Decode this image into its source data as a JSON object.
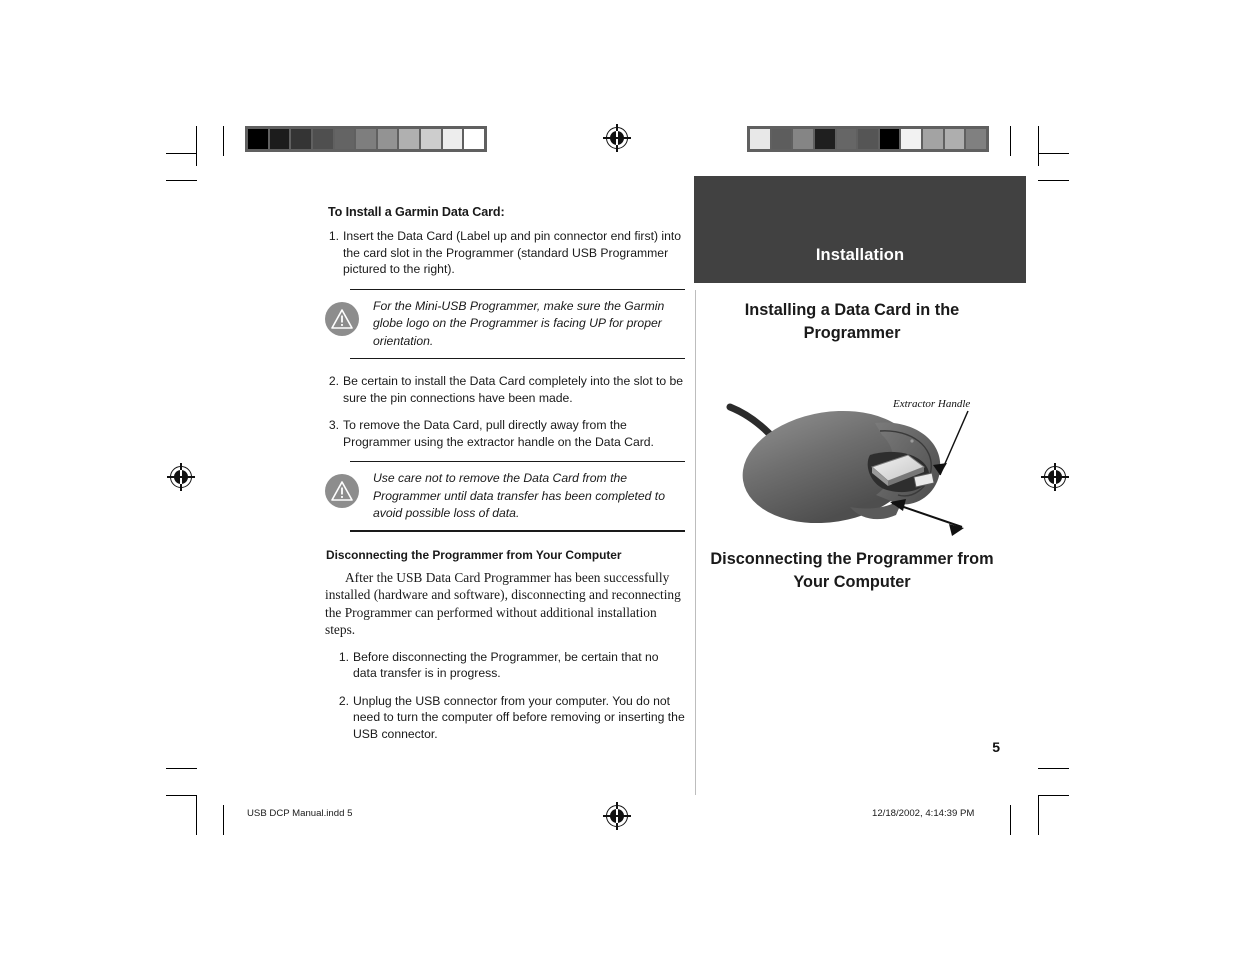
{
  "document": {
    "page_number": "5",
    "chapter_label": "Installation"
  },
  "left_column": {
    "heading": "To Install a Garmin Data Card:",
    "steps": [
      {
        "num": "1.",
        "text": "Insert the Data Card (Label up and pin connector end first) into the card slot in the Programmer (standard USB Programmer pictured to the right)."
      },
      {
        "num": "2.",
        "text": "Be certain to install the Data Card completely into the slot to be sure the pin connections have been made."
      },
      {
        "num": "3.",
        "text": "To remove the Data Card, pull directly away from the Programmer using the extractor handle on the Data Card."
      }
    ],
    "note_1": "For the Mini-USB Programmer, make sure the Garmin globe logo on the Programmer is facing UP for proper orientation.",
    "note_2": "Use care not to remove the Data Card from the Programmer until data transfer has been completed to avoid possible loss of data.",
    "subheading": "Disconnecting the Programmer from Your Computer",
    "paragraph": "After the USB Data Card Programmer has been successfully installed (hardware and software), disconnecting and reconnecting the Programmer can performed without additional installation steps.",
    "disconnect_steps": [
      {
        "num": "1.",
        "text": "Before disconnecting the Programmer, be certain that no data transfer is in progress."
      },
      {
        "num": "2.",
        "text": "Unplug the USB connector from your computer. You do not need to turn the computer off before removing or inserting the USB connector."
      }
    ]
  },
  "right_column": {
    "heading_1": "Installing a Data Card in the Programmer",
    "heading_2": "Disconnecting the Programmer from Your Computer",
    "figure_caption": "Extractor Handle"
  },
  "footer": {
    "file": "USB DCP Manual.indd   5",
    "timestamp": "12/18/2002, 4:14:39 PM"
  },
  "calibration": {
    "left_strip": [
      "#000000",
      "#1c1c1c",
      "#343434",
      "#4f4f4f",
      "#646464",
      "#7e7e7e",
      "#939393",
      "#b0b0b0",
      "#cdcdcd",
      "#ededed",
      "#ffffff"
    ],
    "right_strip": [
      "#e8e8e8",
      "#5d5d5d",
      "#858585",
      "#1f1f1f",
      "#666666",
      "#555555",
      "#000000",
      "#f2f2f2",
      "#a3a3a3",
      "#aeaeae",
      "#808080"
    ],
    "strip_border_color": "#606060"
  },
  "colors": {
    "chapter_band": "#414141",
    "warning_icon": "#8d8d8d",
    "hairline": "#bdbdbd",
    "text": "#1a1a1a"
  },
  "icons": {
    "warning": "warning-triangle-icon",
    "registration": "registration-target-icon"
  }
}
